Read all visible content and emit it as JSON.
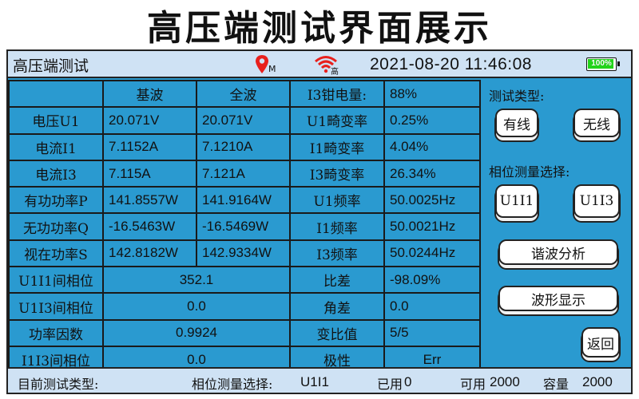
{
  "page_heading": "高压端测试界面展示",
  "header": {
    "title": "高压端测试",
    "location_sub": "M",
    "signal_sub": "高",
    "datetime": "2021-08-20 11:46:08",
    "battery_text": "100%",
    "battery_level": 1.0
  },
  "table": {
    "col_fundamental": "基波",
    "col_full": "全波",
    "rows": [
      {
        "label": "电压U1",
        "fund": "20.071V",
        "full": "20.071V"
      },
      {
        "label": "电流I1",
        "fund": "7.1152A",
        "full": "7.1210A"
      },
      {
        "label": "电流I3",
        "fund": "7.115A",
        "full": "7.121A"
      },
      {
        "label": "有功功率P",
        "fund": "141.8557W",
        "full": "141.9164W"
      },
      {
        "label": "无功功率Q",
        "fund": "-16.5463W",
        "full": "-16.5469W"
      },
      {
        "label": "视在功率S",
        "fund": "142.8182W",
        "full": "142.9334W"
      }
    ],
    "merged": [
      {
        "label": "U1I1间相位",
        "value": "352.1"
      },
      {
        "label": "U1I3间相位",
        "value": "0.0"
      },
      {
        "label": "功率因数",
        "value": "0.9924"
      },
      {
        "label": "I1I3间相位",
        "value": "0.0"
      }
    ],
    "right": [
      {
        "label": "I3钳电量:",
        "value": "88%"
      },
      {
        "label": "U1畸变率",
        "value": "0.25%"
      },
      {
        "label": "I1畸变率",
        "value": "4.04%"
      },
      {
        "label": "I3畸变率",
        "value": "26.34%"
      },
      {
        "label": "U1频率",
        "value": "50.0025Hz"
      },
      {
        "label": "I1频率",
        "value": "50.0021Hz"
      },
      {
        "label": "I3频率",
        "value": "50.0244Hz"
      },
      {
        "label": "比差",
        "value": "-98.09%"
      },
      {
        "label": "角差",
        "value": "0.0"
      },
      {
        "label": "变比值",
        "value": "5/5"
      },
      {
        "label": "极性",
        "value": "Err"
      }
    ]
  },
  "side": {
    "test_type_label": "测试类型:",
    "wired_btn": "有线",
    "wireless_btn": "无线",
    "phase_label": "相位测量选择:",
    "u1i1_btn": "U1I1",
    "u1i3_btn": "U1I3",
    "harmonic_btn": "谐波分析",
    "waveform_btn": "波形显示",
    "back_btn": "返回"
  },
  "status": {
    "current_type_label": "目前测试类型:",
    "phase_select_label": "相位测量选择:",
    "phase_select_value": "U1I1",
    "used_label": "已用",
    "used_value": "0",
    "available_label": "可用",
    "available_value": "2000",
    "capacity_label": "容量",
    "capacity_value": "2000"
  },
  "colors": {
    "panel": "#2a9ad0",
    "bar": "#cfe2f4",
    "battery": "#22d41a",
    "location_icon": "#e8201c",
    "wifi_icon": "#e8201c"
  },
  "icons": [
    "location-pin-icon",
    "wifi-signal-icon",
    "battery-icon"
  ]
}
